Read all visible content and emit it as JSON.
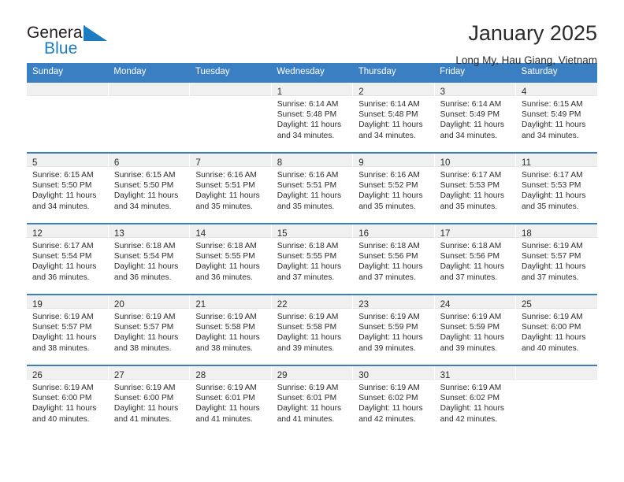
{
  "brand": {
    "name_part1": "General",
    "name_part2": "Blue",
    "mark_color": "#1b7cc2",
    "text_color": "#231f20"
  },
  "header": {
    "title": "January 2025",
    "subtitle": "Long My, Hau Giang, Vietnam"
  },
  "theme": {
    "header_bg": "#3a7fc1",
    "header_text": "#ffffff",
    "daynum_band_bg": "#f0f0f0",
    "cell_bg": "#ffffff",
    "row_border": "#3a7fc1"
  },
  "weekdays": [
    "Sunday",
    "Monday",
    "Tuesday",
    "Wednesday",
    "Thursday",
    "Friday",
    "Saturday"
  ],
  "labels": {
    "sunrise_prefix": "Sunrise:",
    "sunset_prefix": "Sunset:",
    "daylight_prefix": "Daylight:"
  },
  "weeks": [
    [
      {
        "day": "",
        "empty": true,
        "l1": "",
        "l2": "",
        "l3": "",
        "l4": ""
      },
      {
        "day": "",
        "empty": true,
        "l1": "",
        "l2": "",
        "l3": "",
        "l4": ""
      },
      {
        "day": "",
        "empty": true,
        "l1": "",
        "l2": "",
        "l3": "",
        "l4": ""
      },
      {
        "day": "1",
        "empty": false,
        "l1": "Sunrise: 6:14 AM",
        "l2": "Sunset: 5:48 PM",
        "l3": "Daylight: 11 hours",
        "l4": "and 34 minutes."
      },
      {
        "day": "2",
        "empty": false,
        "l1": "Sunrise: 6:14 AM",
        "l2": "Sunset: 5:48 PM",
        "l3": "Daylight: 11 hours",
        "l4": "and 34 minutes."
      },
      {
        "day": "3",
        "empty": false,
        "l1": "Sunrise: 6:14 AM",
        "l2": "Sunset: 5:49 PM",
        "l3": "Daylight: 11 hours",
        "l4": "and 34 minutes."
      },
      {
        "day": "4",
        "empty": false,
        "l1": "Sunrise: 6:15 AM",
        "l2": "Sunset: 5:49 PM",
        "l3": "Daylight: 11 hours",
        "l4": "and 34 minutes."
      }
    ],
    [
      {
        "day": "5",
        "empty": false,
        "l1": "Sunrise: 6:15 AM",
        "l2": "Sunset: 5:50 PM",
        "l3": "Daylight: 11 hours",
        "l4": "and 34 minutes."
      },
      {
        "day": "6",
        "empty": false,
        "l1": "Sunrise: 6:15 AM",
        "l2": "Sunset: 5:50 PM",
        "l3": "Daylight: 11 hours",
        "l4": "and 34 minutes."
      },
      {
        "day": "7",
        "empty": false,
        "l1": "Sunrise: 6:16 AM",
        "l2": "Sunset: 5:51 PM",
        "l3": "Daylight: 11 hours",
        "l4": "and 35 minutes."
      },
      {
        "day": "8",
        "empty": false,
        "l1": "Sunrise: 6:16 AM",
        "l2": "Sunset: 5:51 PM",
        "l3": "Daylight: 11 hours",
        "l4": "and 35 minutes."
      },
      {
        "day": "9",
        "empty": false,
        "l1": "Sunrise: 6:16 AM",
        "l2": "Sunset: 5:52 PM",
        "l3": "Daylight: 11 hours",
        "l4": "and 35 minutes."
      },
      {
        "day": "10",
        "empty": false,
        "l1": "Sunrise: 6:17 AM",
        "l2": "Sunset: 5:53 PM",
        "l3": "Daylight: 11 hours",
        "l4": "and 35 minutes."
      },
      {
        "day": "11",
        "empty": false,
        "l1": "Sunrise: 6:17 AM",
        "l2": "Sunset: 5:53 PM",
        "l3": "Daylight: 11 hours",
        "l4": "and 35 minutes."
      }
    ],
    [
      {
        "day": "12",
        "empty": false,
        "l1": "Sunrise: 6:17 AM",
        "l2": "Sunset: 5:54 PM",
        "l3": "Daylight: 11 hours",
        "l4": "and 36 minutes."
      },
      {
        "day": "13",
        "empty": false,
        "l1": "Sunrise: 6:18 AM",
        "l2": "Sunset: 5:54 PM",
        "l3": "Daylight: 11 hours",
        "l4": "and 36 minutes."
      },
      {
        "day": "14",
        "empty": false,
        "l1": "Sunrise: 6:18 AM",
        "l2": "Sunset: 5:55 PM",
        "l3": "Daylight: 11 hours",
        "l4": "and 36 minutes."
      },
      {
        "day": "15",
        "empty": false,
        "l1": "Sunrise: 6:18 AM",
        "l2": "Sunset: 5:55 PM",
        "l3": "Daylight: 11 hours",
        "l4": "and 37 minutes."
      },
      {
        "day": "16",
        "empty": false,
        "l1": "Sunrise: 6:18 AM",
        "l2": "Sunset: 5:56 PM",
        "l3": "Daylight: 11 hours",
        "l4": "and 37 minutes."
      },
      {
        "day": "17",
        "empty": false,
        "l1": "Sunrise: 6:18 AM",
        "l2": "Sunset: 5:56 PM",
        "l3": "Daylight: 11 hours",
        "l4": "and 37 minutes."
      },
      {
        "day": "18",
        "empty": false,
        "l1": "Sunrise: 6:19 AM",
        "l2": "Sunset: 5:57 PM",
        "l3": "Daylight: 11 hours",
        "l4": "and 37 minutes."
      }
    ],
    [
      {
        "day": "19",
        "empty": false,
        "l1": "Sunrise: 6:19 AM",
        "l2": "Sunset: 5:57 PM",
        "l3": "Daylight: 11 hours",
        "l4": "and 38 minutes."
      },
      {
        "day": "20",
        "empty": false,
        "l1": "Sunrise: 6:19 AM",
        "l2": "Sunset: 5:57 PM",
        "l3": "Daylight: 11 hours",
        "l4": "and 38 minutes."
      },
      {
        "day": "21",
        "empty": false,
        "l1": "Sunrise: 6:19 AM",
        "l2": "Sunset: 5:58 PM",
        "l3": "Daylight: 11 hours",
        "l4": "and 38 minutes."
      },
      {
        "day": "22",
        "empty": false,
        "l1": "Sunrise: 6:19 AM",
        "l2": "Sunset: 5:58 PM",
        "l3": "Daylight: 11 hours",
        "l4": "and 39 minutes."
      },
      {
        "day": "23",
        "empty": false,
        "l1": "Sunrise: 6:19 AM",
        "l2": "Sunset: 5:59 PM",
        "l3": "Daylight: 11 hours",
        "l4": "and 39 minutes."
      },
      {
        "day": "24",
        "empty": false,
        "l1": "Sunrise: 6:19 AM",
        "l2": "Sunset: 5:59 PM",
        "l3": "Daylight: 11 hours",
        "l4": "and 39 minutes."
      },
      {
        "day": "25",
        "empty": false,
        "l1": "Sunrise: 6:19 AM",
        "l2": "Sunset: 6:00 PM",
        "l3": "Daylight: 11 hours",
        "l4": "and 40 minutes."
      }
    ],
    [
      {
        "day": "26",
        "empty": false,
        "l1": "Sunrise: 6:19 AM",
        "l2": "Sunset: 6:00 PM",
        "l3": "Daylight: 11 hours",
        "l4": "and 40 minutes."
      },
      {
        "day": "27",
        "empty": false,
        "l1": "Sunrise: 6:19 AM",
        "l2": "Sunset: 6:00 PM",
        "l3": "Daylight: 11 hours",
        "l4": "and 41 minutes."
      },
      {
        "day": "28",
        "empty": false,
        "l1": "Sunrise: 6:19 AM",
        "l2": "Sunset: 6:01 PM",
        "l3": "Daylight: 11 hours",
        "l4": "and 41 minutes."
      },
      {
        "day": "29",
        "empty": false,
        "l1": "Sunrise: 6:19 AM",
        "l2": "Sunset: 6:01 PM",
        "l3": "Daylight: 11 hours",
        "l4": "and 41 minutes."
      },
      {
        "day": "30",
        "empty": false,
        "l1": "Sunrise: 6:19 AM",
        "l2": "Sunset: 6:02 PM",
        "l3": "Daylight: 11 hours",
        "l4": "and 42 minutes."
      },
      {
        "day": "31",
        "empty": false,
        "l1": "Sunrise: 6:19 AM",
        "l2": "Sunset: 6:02 PM",
        "l3": "Daylight: 11 hours",
        "l4": "and 42 minutes."
      },
      {
        "day": "",
        "empty": true,
        "l1": "",
        "l2": "",
        "l3": "",
        "l4": ""
      }
    ]
  ]
}
